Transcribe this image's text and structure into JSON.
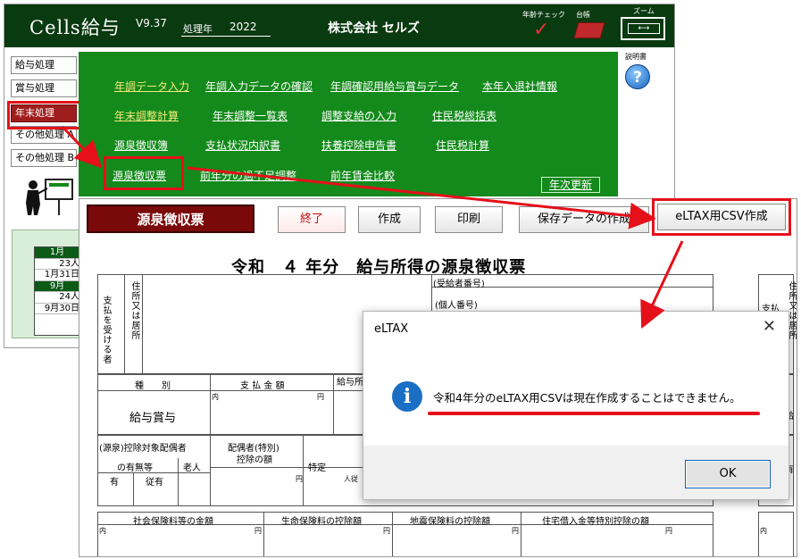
{
  "app": {
    "title": "Cells給与",
    "version": "V9.37",
    "year_label": "処理年",
    "year_value": "2022",
    "company": "株式会社 セルズ",
    "age_check_label": "年齢チェック",
    "ledger_label": "台帳",
    "zoom_label": "ズーム",
    "help_label": "説明書"
  },
  "sidebar": {
    "items": [
      {
        "label": "給与処理"
      },
      {
        "label": "賞与処理"
      },
      {
        "label": "年末処理"
      },
      {
        "label": "その他処理 A"
      },
      {
        "label": "その他処理 B"
      }
    ]
  },
  "calendar": {
    "rows": [
      "1月",
      "23人",
      "1月31日",
      "9月",
      "24人",
      "9月30日"
    ]
  },
  "menu": {
    "row1": [
      "年調データ入力",
      "年調入力データの確認",
      "年調確認用給与賞与データ",
      "本年入退社情報"
    ],
    "row2": [
      "年末調整計算",
      "年末調整一覧表",
      "調整支給の入力",
      "住民税総括表"
    ],
    "row3": [
      "源泉徴収簿",
      "支払状況内訳書",
      "扶養控除申告書",
      "住民税計算"
    ],
    "row4": [
      "源泉徴収票",
      "前年分の過不足調整",
      "前年賃金比較"
    ],
    "year_update": "年次更新"
  },
  "doc": {
    "title": "源泉徴収票",
    "buttons": {
      "end": "終了",
      "create": "作成",
      "print": "印刷",
      "save": "保存データの作成",
      "csv": "eLTAX用CSV作成"
    },
    "heading": "令和　４ 年分　給与所得の源泉徴収票",
    "form": {
      "payee_label": "支払を受ける者",
      "address_label": "住所又は居所",
      "recipient_no": "(受給者番号)",
      "personal_no": "(個人番号)",
      "type_header": "種　　別",
      "amount_header": "支 払 金 額",
      "income_header": "給与所",
      "type_value": "給与賞与",
      "yen1": "内",
      "yen2": "円",
      "spouse_label": "(源泉)控除対象配偶者",
      "spouse_sub": "の有無等",
      "elder": "老人",
      "spouse_special": "配偶者(特別)",
      "spouse_special2": "控除の額",
      "specific": "特定",
      "yes": "有",
      "from_yes": "従有",
      "person": "人",
      "from": "従",
      "social_ins": "社会保険料等の金額",
      "life_ins": "生命保険料の控除額",
      "quake_ins": "地震保険料の控除額",
      "housing": "住宅借入金等特別控除の額",
      "right_payee": "支払",
      "right_addr": "住所又は居所",
      "right_kyu": "給",
      "right_yu": "有",
      "right_naka": "内"
    }
  },
  "dialog": {
    "title": "eLTAX",
    "message": "令和4年分のeLTAX用CSVは現在作成することはできません。",
    "ok": "OK"
  },
  "colors": {
    "header_green": "#0a3a10",
    "panel_green": "#138a1b",
    "highlight_red": "#e5101a",
    "title_maroon": "#7a0a0a",
    "info_blue": "#1a6fc4"
  }
}
